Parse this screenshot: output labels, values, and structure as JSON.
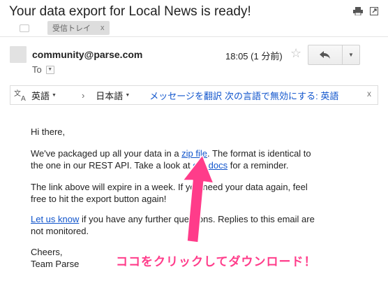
{
  "header": {
    "subject": "Your data export for Local News is ready!",
    "label": "受信トレイ",
    "label_close": "x"
  },
  "message": {
    "sender": "community@parse.com",
    "to_label": "To",
    "time": "18:05 (1 分前)"
  },
  "translate": {
    "source_lang": "英語",
    "target_lang": "日本語",
    "translate_link": "メッセージを翻訳",
    "disable_link": "次の言語で無効にする: 英語",
    "close": "x"
  },
  "body": {
    "greeting": "Hi there,",
    "p1_a": "We've packaged up all your data in a ",
    "p1_link1": "zip file",
    "p1_b": ". The format is identical to",
    "p1_c": "the one in our REST API. Take a look at ",
    "p1_link2": "our docs",
    "p1_d": " for a reminder.",
    "p2_a": "The link above will expire in a week. If you need your data again, feel",
    "p2_b": "free to hit the export button again!",
    "p3_link": "Let us know",
    "p3_a": " if you have any further questions. Replies to this email are",
    "p3_b": "not monitored.",
    "closing1": "Cheers,",
    "closing2": "Team Parse"
  },
  "annotation": {
    "text": "ココをクリックしてダウンロード！",
    "color": "#ff3c8a"
  },
  "icons": [
    "print-icon",
    "new-window-icon",
    "label-tag-icon",
    "star-icon",
    "reply-icon",
    "chevron-down-icon",
    "translate-icon",
    "arrow-right-icon",
    "close-icon"
  ]
}
